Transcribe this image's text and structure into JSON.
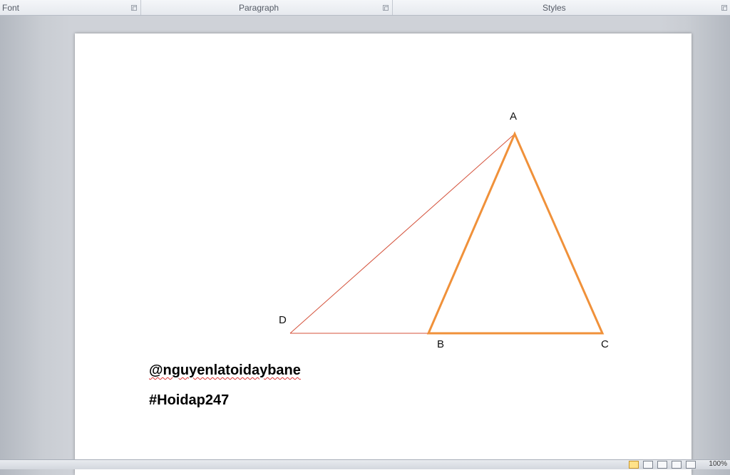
{
  "ribbon": {
    "groups": [
      {
        "label": "Font"
      },
      {
        "label": "Paragraph"
      },
      {
        "label": "Styles"
      }
    ]
  },
  "document": {
    "points": {
      "a": "A",
      "b": "B",
      "c": "C",
      "d": "D"
    },
    "lines": [
      "@nguyenlatoidaybane",
      "#Hoidap247"
    ],
    "colors": {
      "triangle": "#f0913a",
      "line_ad_db": "#d4513a"
    }
  },
  "statusbar": {
    "zoom": "100%",
    "views": [
      "print-layout",
      "full-screen-reading",
      "web-layout",
      "outline",
      "draft"
    ]
  }
}
